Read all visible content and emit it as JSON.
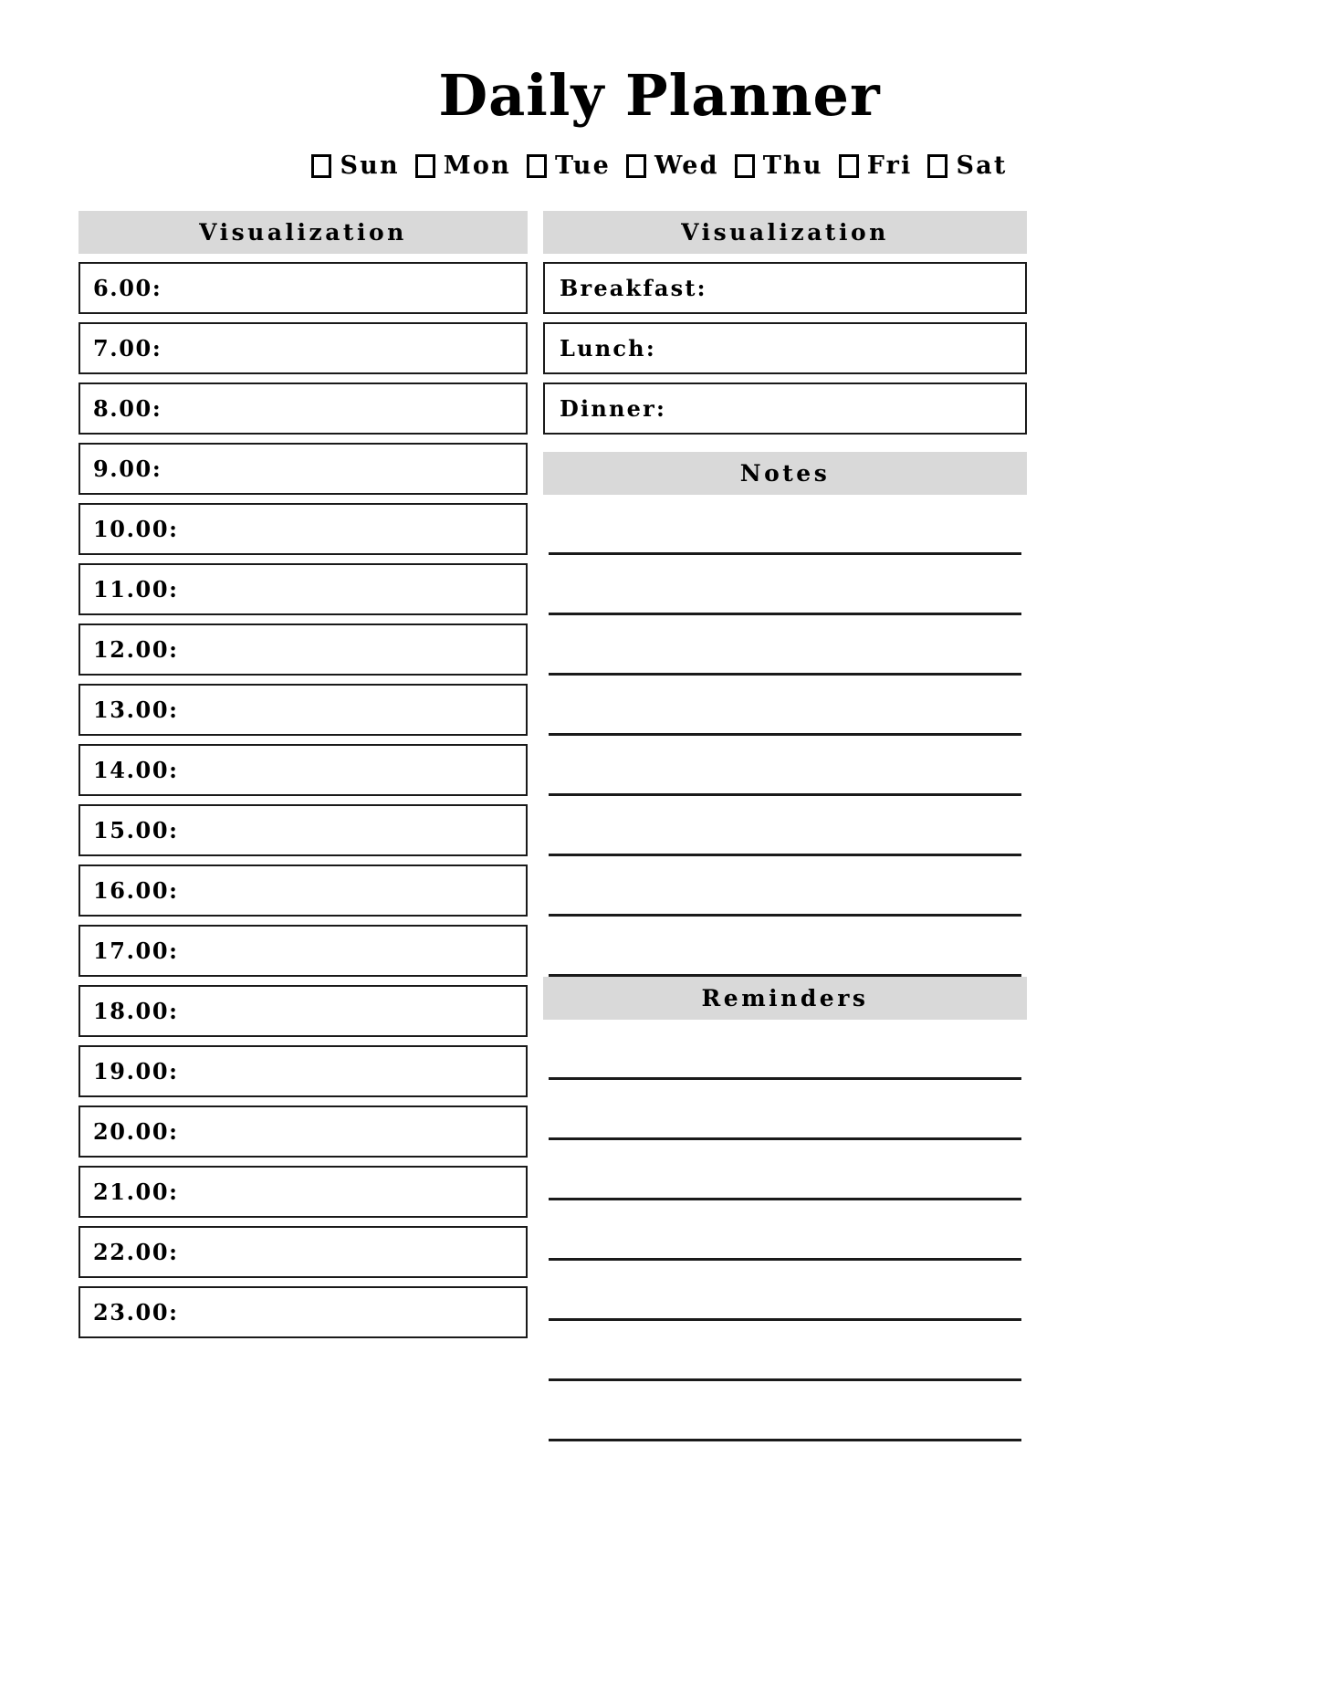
{
  "document": {
    "title": "Daily Planner"
  },
  "weekdays": {
    "items": [
      {
        "label": "Sun",
        "checked": false
      },
      {
        "label": "Mon",
        "checked": false
      },
      {
        "label": "Tue",
        "checked": false
      },
      {
        "label": "Wed",
        "checked": false
      },
      {
        "label": "Thu",
        "checked": false
      },
      {
        "label": "Fri",
        "checked": false
      },
      {
        "label": "Sat",
        "checked": false
      }
    ]
  },
  "schedule": {
    "header": "Visualization",
    "slots": [
      {
        "label": "6.00:",
        "value": ""
      },
      {
        "label": "7.00:",
        "value": ""
      },
      {
        "label": "8.00:",
        "value": ""
      },
      {
        "label": "9.00:",
        "value": ""
      },
      {
        "label": "10.00:",
        "value": ""
      },
      {
        "label": "11.00:",
        "value": ""
      },
      {
        "label": "12.00:",
        "value": ""
      },
      {
        "label": "13.00:",
        "value": ""
      },
      {
        "label": "14.00:",
        "value": ""
      },
      {
        "label": "15.00:",
        "value": ""
      },
      {
        "label": "16.00:",
        "value": ""
      },
      {
        "label": "17.00:",
        "value": ""
      },
      {
        "label": "18.00:",
        "value": ""
      },
      {
        "label": "19.00:",
        "value": ""
      },
      {
        "label": "20.00:",
        "value": ""
      },
      {
        "label": "21.00:",
        "value": ""
      },
      {
        "label": "22.00:",
        "value": ""
      },
      {
        "label": "23.00:",
        "value": ""
      }
    ]
  },
  "meals": {
    "header": "Visualization",
    "slots": [
      {
        "label": "Breakfast:",
        "value": ""
      },
      {
        "label": "Lunch:",
        "value": ""
      },
      {
        "label": "Dinner:",
        "value": ""
      }
    ]
  },
  "notes": {
    "header": "Notes",
    "line_count": 8,
    "lines": [
      "",
      "",
      "",
      "",
      "",
      "",
      "",
      ""
    ]
  },
  "reminders": {
    "header": "Reminders",
    "line_count": 7,
    "lines": [
      "",
      "",
      "",
      "",
      "",
      "",
      ""
    ]
  },
  "colors": {
    "section_header_background": "#d9d9d9",
    "border": "#1a1a1a",
    "text": "#000000",
    "page_background": "#ffffff"
  }
}
